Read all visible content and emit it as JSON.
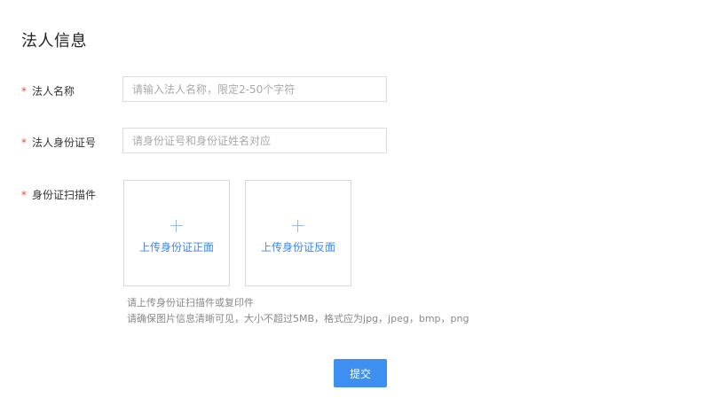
{
  "page_title": "法人信息",
  "required_mark": "*",
  "fields": {
    "name": {
      "label": "法人名称",
      "value": "",
      "placeholder": "请输入法人名称，限定2-50个字符"
    },
    "id_number": {
      "label": "法人身份证号",
      "value": "",
      "placeholder": "请身份证号和身份证姓名对应"
    }
  },
  "id_scan": {
    "label": "身份证扫描件",
    "upload_front": {
      "icon": "plus-icon",
      "label": "上传身份证正面"
    },
    "upload_back": {
      "icon": "plus-icon",
      "label": "上传身份证反面"
    },
    "hint_line1": "请上传身份证扫描件或复印件",
    "hint_line2": "请确保图片信息清晰可见，大小不超过5MB，格式应为jpg，jpeg，bmp，png"
  },
  "submit_label": "提交",
  "colors": {
    "required": "#f04a3a",
    "link": "#3d86f0",
    "primary_button": "#3d8ff2",
    "border": "#dcdcdc"
  }
}
